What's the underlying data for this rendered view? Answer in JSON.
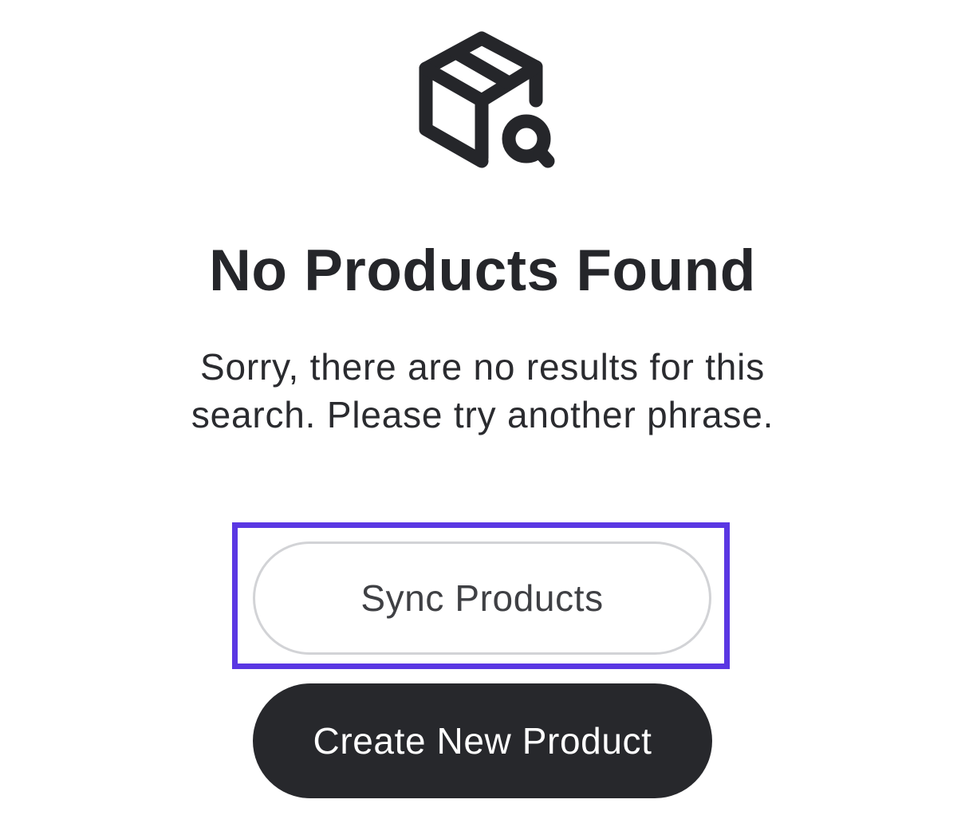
{
  "empty_state": {
    "icon": "package-search-icon",
    "title": "No Products Found",
    "message_line1": "Sorry, there are no results for this",
    "message_line2": "search. Please try another phrase."
  },
  "actions": {
    "sync_label": "Sync Products",
    "create_label": "Create New Product"
  },
  "colors": {
    "text": "#26272b",
    "highlight": "#5a37e3",
    "primary_button": "#27282c",
    "secondary_border": "#d2d3d6"
  }
}
